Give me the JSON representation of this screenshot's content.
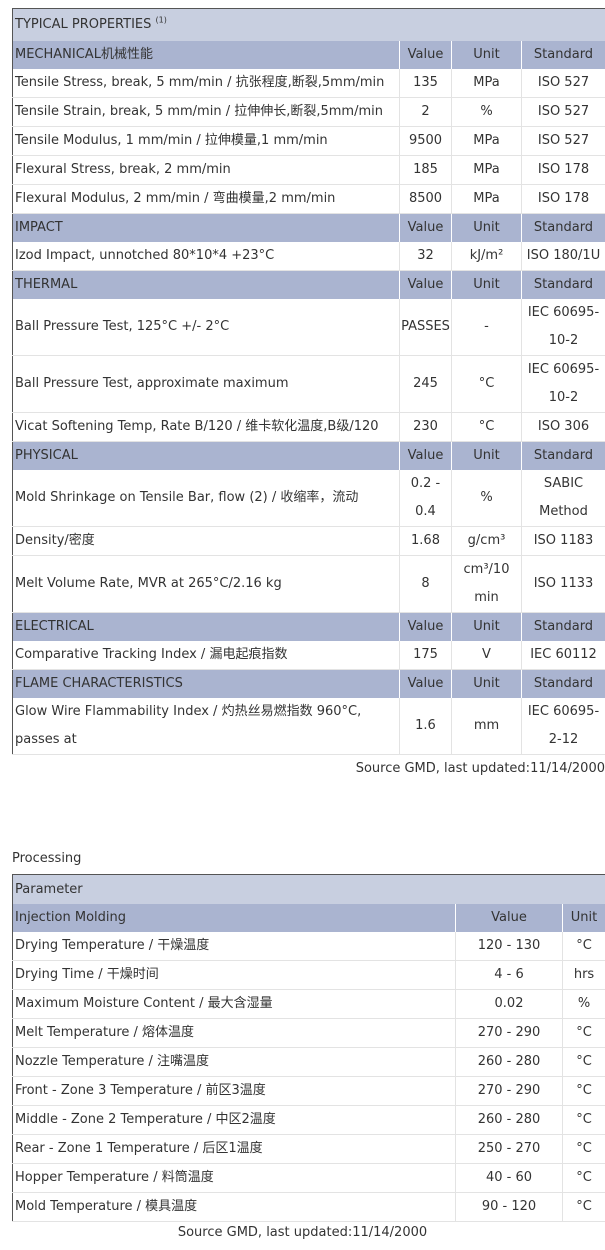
{
  "properties": {
    "title": "TYPICAL PROPERTIES",
    "title_sup": "(1)",
    "columns": {
      "value": "Value",
      "unit": "Unit",
      "standard": "Standard"
    },
    "sections": [
      {
        "name": "MECHANICAL机械性能",
        "rows": [
          {
            "property": "Tensile Stress, break, 5 mm/min / 抗张程度,断裂,5mm/min",
            "value": "135",
            "unit": "MPa",
            "standard": "ISO 527"
          },
          {
            "property": "Tensile Strain, break, 5 mm/min / 拉伸伸长,断裂,5mm/min",
            "value": "2",
            "unit": "%",
            "standard": "ISO 527"
          },
          {
            "property": "Tensile Modulus, 1 mm/min / 拉伸模量,1 mm/min",
            "value": "9500",
            "unit": "MPa",
            "standard": "ISO 527"
          },
          {
            "property": "Flexural Stress, break, 2 mm/min",
            "value": "185",
            "unit": "MPa",
            "standard": "ISO 178"
          },
          {
            "property": "Flexural Modulus, 2 mm/min / 弯曲模量,2 mm/min",
            "value": "8500",
            "unit": "MPa",
            "standard": "ISO 178"
          }
        ]
      },
      {
        "name": "IMPACT",
        "rows": [
          {
            "property": "Izod Impact, unnotched 80*10*4 +23°C",
            "value": "32",
            "unit": "kJ/m²",
            "standard": "ISO 180/1U"
          }
        ]
      },
      {
        "name": "THERMAL",
        "rows": [
          {
            "property": "Ball Pressure Test, 125°C +/- 2°C",
            "value": "PASSES",
            "unit": "-",
            "standard": "IEC 60695-10-2"
          },
          {
            "property": "Ball Pressure Test, approximate maximum",
            "value": "245",
            "unit": "°C",
            "standard": "IEC 60695-10-2"
          },
          {
            "property": "Vicat Softening Temp, Rate B/120 / 维卡软化温度,B级/120",
            "value": "230",
            "unit": "°C",
            "standard": "ISO 306"
          }
        ]
      },
      {
        "name": "PHYSICAL",
        "rows": [
          {
            "property": "Mold Shrinkage on Tensile Bar, flow (2) / 收缩率，流动",
            "value": "0.2 - 0.4",
            "unit": "%",
            "standard": "SABIC Method"
          },
          {
            "property": "Density/密度",
            "value": "1.68",
            "unit": "g/cm³",
            "standard": "ISO 1183"
          },
          {
            "property": "Melt Volume Rate, MVR at 265°C/2.16 kg",
            "value": "8",
            "unit": "cm³/10 min",
            "standard": "ISO 1133"
          }
        ]
      },
      {
        "name": "ELECTRICAL",
        "rows": [
          {
            "property": "Comparative Tracking Index / 漏电起痕指数",
            "value": "175",
            "unit": "V",
            "standard": "IEC 60112"
          }
        ]
      },
      {
        "name": "FLAME CHARACTERISTICS",
        "rows": [
          {
            "property": "Glow Wire Flammability Index / 灼热丝易燃指数 960°C, passes at",
            "value": "1.6",
            "unit": "mm",
            "standard": "IEC 60695-2-12"
          }
        ]
      }
    ],
    "source": "Source GMD, last updated:11/14/2000"
  },
  "processing": {
    "label": "Processing",
    "parameter_header": "Parameter",
    "section_name": "Injection Molding",
    "columns": {
      "value": "Value",
      "unit": "Unit"
    },
    "rows": [
      {
        "parameter": "Drying Temperature / 干燥温度",
        "value": "120 - 130",
        "unit": "°C"
      },
      {
        "parameter": "Drying Time / 干燥时间",
        "value": "4 - 6",
        "unit": "hrs"
      },
      {
        "parameter": "Maximum Moisture Content / 最大含湿量",
        "value": "0.02",
        "unit": "%"
      },
      {
        "parameter": "Melt Temperature / 熔体温度",
        "value": "270 - 290",
        "unit": "°C"
      },
      {
        "parameter": "Nozzle Temperature / 注嘴温度",
        "value": "260 - 280",
        "unit": "°C"
      },
      {
        "parameter": "Front - Zone 3 Temperature / 前区3温度",
        "value": "270 - 290",
        "unit": "°C"
      },
      {
        "parameter": "Middle - Zone 2 Temperature / 中区2温度",
        "value": "260 - 280",
        "unit": "°C"
      },
      {
        "parameter": "Rear - Zone 1 Temperature / 后区1温度",
        "value": "250 - 270",
        "unit": "°C"
      },
      {
        "parameter": "Hopper Temperature / 料筒温度",
        "value": "40 - 60",
        "unit": "°C"
      },
      {
        "parameter": "Mold Temperature / 模具温度",
        "value": "90 - 120",
        "unit": "°C"
      }
    ],
    "source": "Source GMD, last updated:11/14/2000"
  }
}
